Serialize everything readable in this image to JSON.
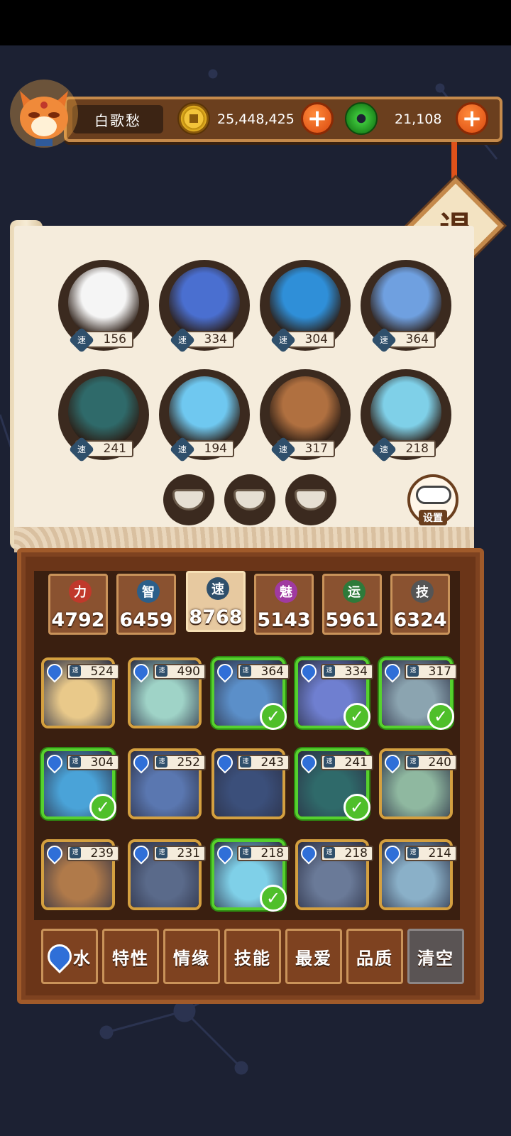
{
  "player": {
    "name": "白歌愁"
  },
  "currency": {
    "gold": {
      "value": "25,448,425",
      "icon": "gold-coin-icon",
      "color": "#f3c43a"
    },
    "jade": {
      "value": "21,108",
      "icon": "jade-ring-icon",
      "color": "#3cc43a"
    },
    "add_label": "+"
  },
  "exit": {
    "label": "退"
  },
  "team": {
    "speed_label": "速",
    "slots": [
      {
        "name": "mahjong-north-tile",
        "speed": "156"
      },
      {
        "name": "blue-haired-fox-girl",
        "speed": "334"
      },
      {
        "name": "water-wave-hero",
        "speed": "304"
      },
      {
        "name": "blue-ninja-with-white-beast",
        "speed": "364"
      },
      {
        "name": "dragon-scholar",
        "speed": "241"
      },
      {
        "name": "dragon-girl",
        "speed": "194"
      },
      {
        "name": "bronze-rat-tile",
        "speed": "317"
      },
      {
        "name": "cyan-haired-reader",
        "speed": "218"
      }
    ],
    "bowls": 3,
    "settings_label": "设置"
  },
  "stats": [
    {
      "key": "力",
      "value": "4792",
      "color": "#c0392b"
    },
    {
      "key": "智",
      "value": "6459",
      "color": "#2c5f8a"
    },
    {
      "key": "速",
      "value": "8768",
      "color": "#2f4f6b",
      "active": true
    },
    {
      "key": "魅",
      "value": "5143",
      "color": "#a03aa0"
    },
    {
      "key": "运",
      "value": "5961",
      "color": "#2e7a3a"
    },
    {
      "key": "技",
      "value": "6324",
      "color": "#555555"
    }
  ],
  "heroes": [
    {
      "speed": "524",
      "selected": false,
      "tone": "#e9c98a"
    },
    {
      "speed": "490",
      "selected": false,
      "tone": "#9fd3c7"
    },
    {
      "speed": "364",
      "selected": true,
      "tone": "#5b8fc9"
    },
    {
      "speed": "334",
      "selected": true,
      "tone": "#6f7fd0"
    },
    {
      "speed": "317",
      "selected": true,
      "tone": "#8ba4b0"
    },
    {
      "speed": "304",
      "selected": true,
      "tone": "#4aa3d8"
    },
    {
      "speed": "252",
      "selected": false,
      "tone": "#5a77b0"
    },
    {
      "speed": "243",
      "selected": false,
      "tone": "#3b4f7a"
    },
    {
      "speed": "241",
      "selected": true,
      "tone": "#2f6a6a"
    },
    {
      "speed": "240",
      "selected": false,
      "tone": "#8fb8a0"
    },
    {
      "speed": "239",
      "selected": false,
      "tone": "#b07a4a"
    },
    {
      "speed": "231",
      "selected": false,
      "tone": "#5a6a8a"
    },
    {
      "speed": "218",
      "selected": true,
      "tone": "#7fd0e8"
    },
    {
      "speed": "218",
      "selected": false,
      "tone": "#6a7a98"
    },
    {
      "speed": "214",
      "selected": false,
      "tone": "#8ab0c8"
    }
  ],
  "filters": [
    {
      "label": "水",
      "icon": "water-drop-icon"
    },
    {
      "label": "特性"
    },
    {
      "label": "情缘"
    },
    {
      "label": "技能"
    },
    {
      "label": "最爱"
    },
    {
      "label": "品质"
    },
    {
      "label": "清空"
    }
  ]
}
